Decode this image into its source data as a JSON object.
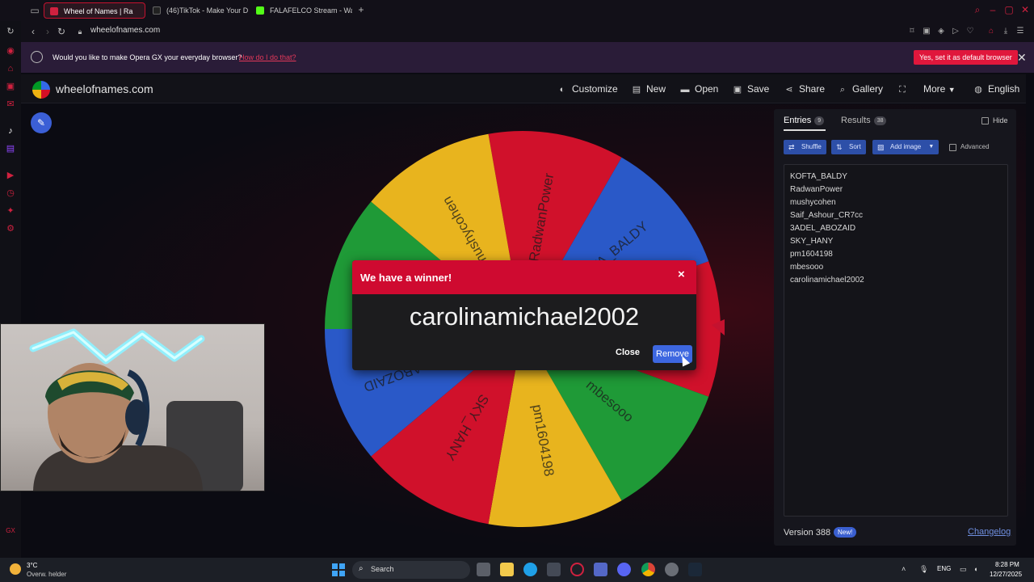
{
  "browser": {
    "tabs": [
      {
        "label": "Wheel of Names | Ra",
        "active": true,
        "color": "#d0213f"
      },
      {
        "label": "(46)TikTok - Make Your D",
        "active": false,
        "color": "#222222"
      },
      {
        "label": "FALAFELCO Stream - Wa",
        "active": false,
        "color": "#53fc18"
      }
    ],
    "new_tab_icon": "plus-icon",
    "url": "wheelofnames.com"
  },
  "banner": {
    "text": "Would you like to make Opera GX your everyday browser?",
    "link": "How do I do that?",
    "button": "Yes, set it as default browser"
  },
  "header": {
    "site_name": "wheelofnames.com",
    "menu": [
      {
        "label": "Customize",
        "icon": "palette-icon"
      },
      {
        "label": "New",
        "icon": "file-icon"
      },
      {
        "label": "Open",
        "icon": "folder-icon"
      },
      {
        "label": "Save",
        "icon": "save-icon"
      },
      {
        "label": "Share",
        "icon": "share-icon"
      },
      {
        "label": "Gallery",
        "icon": "search-icon"
      },
      {
        "label": "",
        "icon": "fullscreen-icon"
      },
      {
        "label": "More",
        "icon": "chevron-down-icon"
      },
      {
        "label": "English",
        "icon": "globe-icon"
      }
    ]
  },
  "wheel": {
    "segments": [
      {
        "label": "RadwanPower",
        "color": "#d0112b"
      },
      {
        "label": "KOFTA_BALDY",
        "color": "#2a59c8"
      },
      {
        "label": "carolinamichael20...",
        "color": "#d0112b"
      },
      {
        "label": "mbesooo",
        "color": "#1f9a37"
      },
      {
        "label": "pm1604198",
        "color": "#e8b41e"
      },
      {
        "label": "SKY_HANY",
        "color": "#d0112b"
      },
      {
        "label": "3ADEL_ABOZAID",
        "color": "#2a59c8"
      },
      {
        "label": "Saif_Ashour_CR7cc",
        "color": "#1f9a37"
      },
      {
        "label": "mushycohen",
        "color": "#e8b41e"
      }
    ]
  },
  "dialog": {
    "title": "We have a winner!",
    "winner": "carolinamichael2002",
    "close_label": "Close",
    "remove_label": "Remove"
  },
  "panel": {
    "tabs": [
      {
        "label": "Entries",
        "count": "9"
      },
      {
        "label": "Results",
        "count": "38"
      }
    ],
    "hide_label": "Hide",
    "buttons": {
      "shuffle": "Shuffle",
      "sort": "Sort",
      "add_image": "Add image"
    },
    "advanced_label": "Advanced",
    "entries": [
      "KOFTA_BALDY",
      "RadwanPower",
      "mushycohen",
      "Saif_Ashour_CR7cc",
      "3ADEL_ABOZAID",
      "SKY_HANY",
      "pm1604198",
      "mbesooo",
      "carolinamichael2002"
    ],
    "version": "Version 388",
    "new_badge": "New!",
    "changelog": "Changelog"
  },
  "taskbar": {
    "weather_temp": "3°C",
    "weather_desc": "Overw. helder",
    "search": "Search",
    "lang": "ENG",
    "time": "8:28 PM",
    "date": "12/27/2025"
  }
}
